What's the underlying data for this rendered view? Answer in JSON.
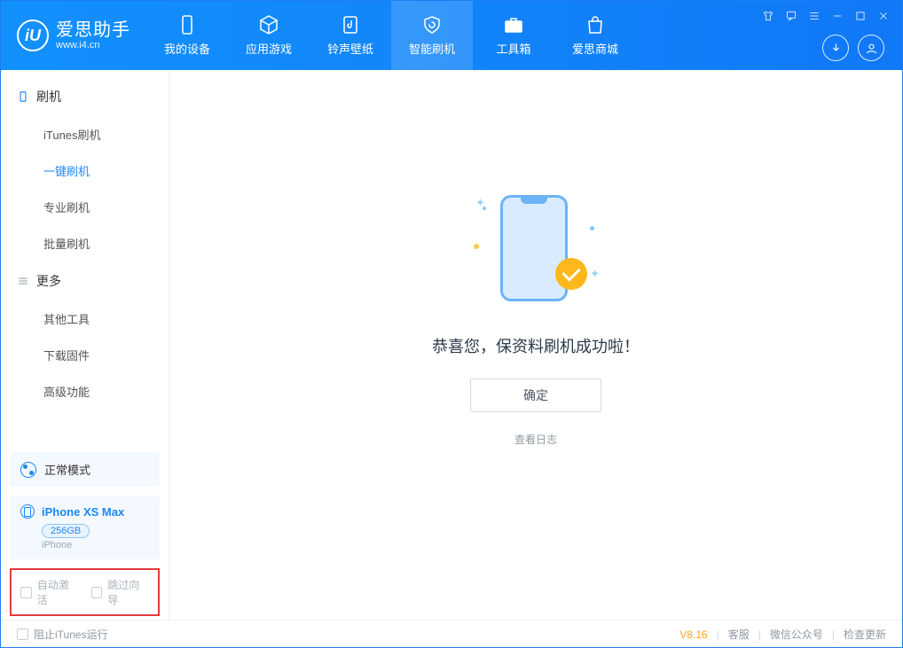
{
  "app": {
    "name": "爱思助手",
    "url": "www.i4.cn",
    "logo_letter": "iU"
  },
  "tabs": [
    {
      "label": "我的设备"
    },
    {
      "label": "应用游戏"
    },
    {
      "label": "铃声壁纸"
    },
    {
      "label": "智能刷机"
    },
    {
      "label": "工具箱"
    },
    {
      "label": "爱思商城"
    }
  ],
  "sidebar": {
    "group1_title": "刷机",
    "items1": [
      {
        "label": "iTunes刷机"
      },
      {
        "label": "一键刷机"
      },
      {
        "label": "专业刷机"
      },
      {
        "label": "批量刷机"
      }
    ],
    "group2_title": "更多",
    "items2": [
      {
        "label": "其他工具"
      },
      {
        "label": "下载固件"
      },
      {
        "label": "高级功能"
      }
    ]
  },
  "mode": {
    "label": "正常模式"
  },
  "device": {
    "name": "iPhone XS Max",
    "storage": "256GB",
    "type": "iPhone"
  },
  "options": {
    "auto_activate": "自动激活",
    "skip_guide": "跳过向导"
  },
  "main": {
    "success": "恭喜您，保资料刷机成功啦！",
    "ok": "确定",
    "view_log": "查看日志"
  },
  "footer": {
    "block_itunes": "阻止iTunes运行",
    "version": "V8.16",
    "service": "客服",
    "wechat": "微信公众号",
    "check_update": "检查更新"
  }
}
